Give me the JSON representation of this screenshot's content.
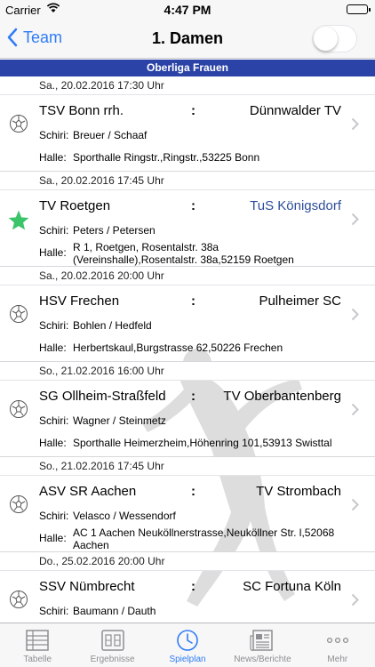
{
  "status_bar": {
    "carrier": "Carrier",
    "time": "4:47 PM"
  },
  "nav": {
    "back_label": "Team",
    "title": "1. Damen",
    "toggle_on": false
  },
  "section": {
    "title": "Oberliga Frauen"
  },
  "colors": {
    "accent": "#2f7cf6",
    "section_bg": "#2b43a6",
    "highlight_team": "#2e4e9b",
    "star": "#3cc46a"
  },
  "labels": {
    "referee": "Schiri:",
    "venue": "Halle:",
    "separator": ":"
  },
  "matches": [
    {
      "date": "Sa., 20.02.2016 17:30 Uhr",
      "home": "TSV Bonn rrh.",
      "away": "Dünnwalder TV",
      "referee": "Breuer / Schaaf",
      "venue": "Sporthalle Ringstr.,Ringstr.,53225 Bonn",
      "icon": "handball-icon"
    },
    {
      "date": "Sa., 20.02.2016 17:45 Uhr",
      "home": "TV Roetgen",
      "away": "TuS Königsdorf",
      "referee": "Peters / Petersen",
      "venue": "R 1, Roetgen, Rosentalstr. 38a (Vereinshalle),Rosentalstr. 38a,52159 Roetgen",
      "icon": "star-icon"
    },
    {
      "date": "Sa., 20.02.2016 20:00 Uhr",
      "home": "HSV Frechen",
      "away": "Pulheimer SC",
      "referee": "Bohlen / Hedfeld",
      "venue": "Herbertskaul,Burgstrasse 62,50226 Frechen",
      "icon": "handball-icon"
    },
    {
      "date": "So., 21.02.2016 16:00 Uhr",
      "home": "SG Ollheim-Straßfeld",
      "away": "TV Oberbantenberg",
      "referee": "Wagner / Steinmetz",
      "venue": "Sporthalle Heimerzheim,Höhenring 101,53913 Swisttal",
      "icon": "handball-icon"
    },
    {
      "date": "So., 21.02.2016 17:45 Uhr",
      "home": "ASV SR Aachen",
      "away": "TV Strombach",
      "referee": "Velasco / Wessendorf",
      "venue": "AC 1 Aachen Neuköllnerstrasse,Neuköllner Str.  l,52068 Aachen",
      "icon": "handball-icon"
    },
    {
      "date": "Do., 25.02.2016 20:00 Uhr",
      "home": "SSV Nümbrecht",
      "away": "SC Fortuna Köln",
      "referee": "Baumann / Dauth",
      "venue": "",
      "icon": "handball-icon"
    }
  ],
  "tabs": [
    {
      "label": "Tabelle",
      "icon": "table-icon",
      "active": false
    },
    {
      "label": "Ergebnisse",
      "icon": "scoreboard-icon",
      "active": false
    },
    {
      "label": "Spielplan",
      "icon": "clock-icon",
      "active": true
    },
    {
      "label": "News/Berichte",
      "icon": "newspaper-icon",
      "active": false
    },
    {
      "label": "Mehr",
      "icon": "more-icon",
      "active": false
    }
  ]
}
